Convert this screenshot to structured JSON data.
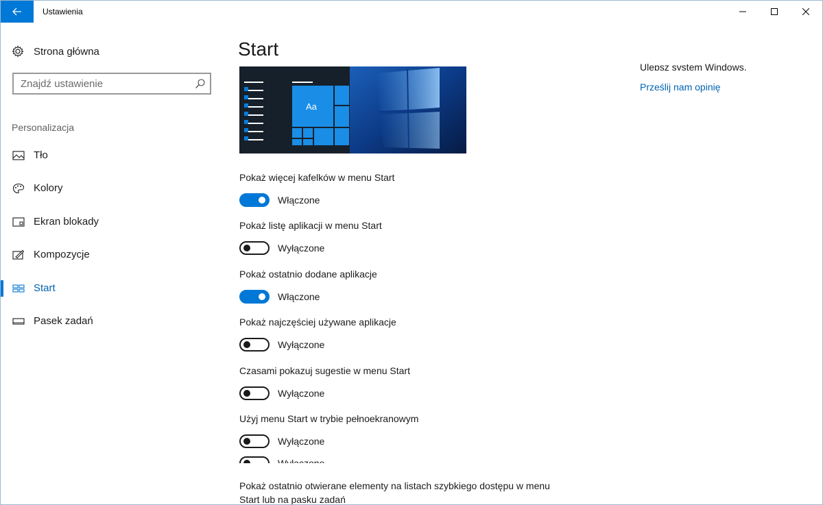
{
  "window": {
    "title": "Ustawienia"
  },
  "sidebar": {
    "home_label": "Strona główna",
    "search_placeholder": "Znajdź ustawienie",
    "section_label": "Personalizacja",
    "items": [
      {
        "label": "Tło",
        "icon": "picture-icon",
        "active": false
      },
      {
        "label": "Kolory",
        "icon": "palette-icon",
        "active": false
      },
      {
        "label": "Ekran blokady",
        "icon": "lock-screen-icon",
        "active": false
      },
      {
        "label": "Kompozycje",
        "icon": "themes-brush-icon",
        "active": false
      },
      {
        "label": "Start",
        "icon": "start-tiles-icon",
        "active": true
      },
      {
        "label": "Pasek zadań",
        "icon": "taskbar-icon",
        "active": false
      }
    ]
  },
  "main": {
    "page_title": "Start",
    "preview": {
      "tile_label": "Aa"
    },
    "settings": [
      {
        "title": "Pokaż więcej kafelków w menu Start",
        "on": true,
        "state": "Włączone"
      },
      {
        "title": "Pokaż listę aplikacji w menu Start",
        "on": false,
        "state": "Wyłączone"
      },
      {
        "title": "Pokaż ostatnio dodane aplikacje",
        "on": true,
        "state": "Włączone"
      },
      {
        "title": "Pokaż najczęściej używane aplikacje",
        "on": false,
        "state": "Wyłączone"
      },
      {
        "title": "Czasami pokazuj sugestie w menu Start",
        "on": false,
        "state": "Wyłączone"
      },
      {
        "title": "Użyj menu Start w trybie pełnoekranowym",
        "on": false,
        "state": "Wyłączone"
      }
    ],
    "ghost_state": "Wyłączone",
    "last_setting_title": "Pokaż ostatnio otwierane elementy na listach szybkiego dostępu w menu Start lub na pasku zadań"
  },
  "right_panel": {
    "improve_text": "Ulepsz system Windows.",
    "feedback_link": "Prześlij nam opinię"
  },
  "colors": {
    "accent": "#0078d7",
    "accent_text": "#0063b1"
  }
}
